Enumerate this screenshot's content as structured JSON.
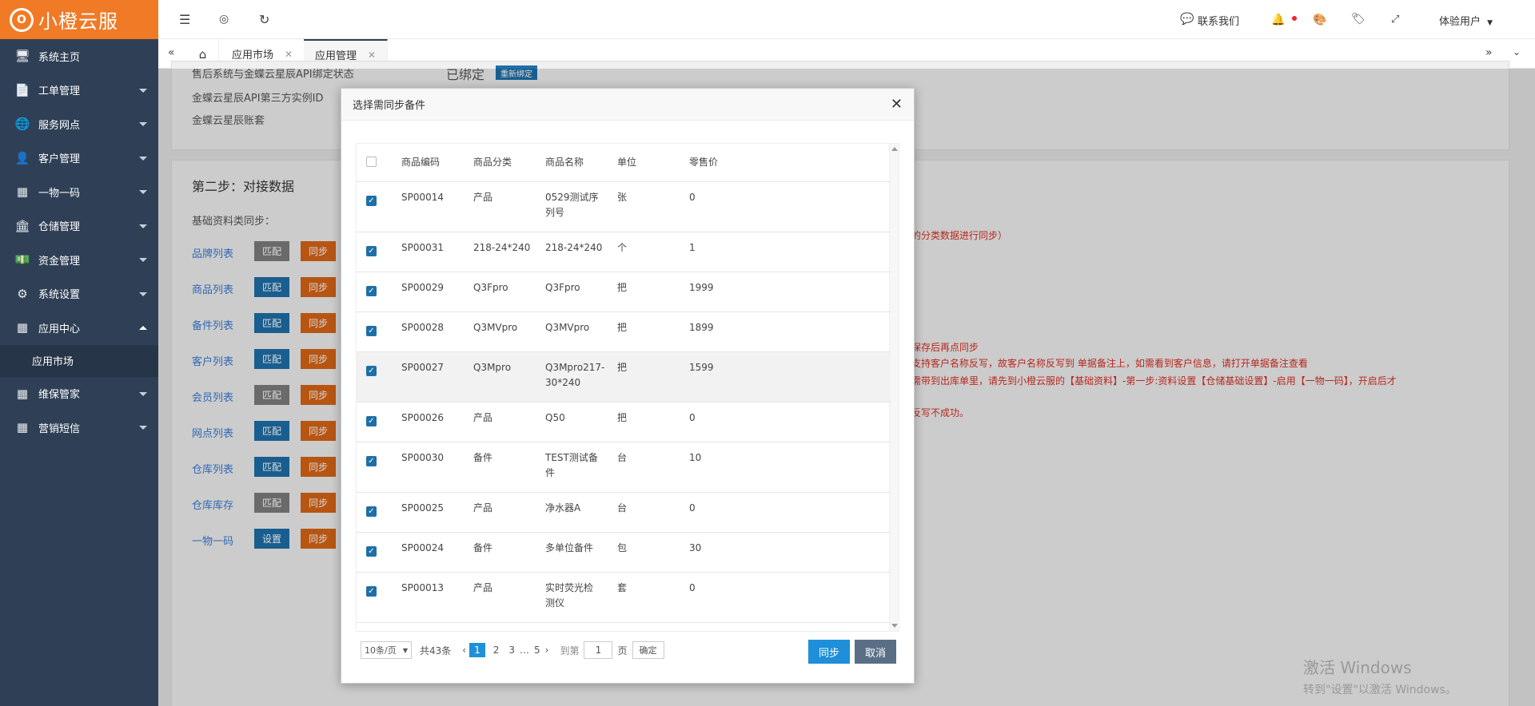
{
  "logo": {
    "mark": "O",
    "text": "小橙云服"
  },
  "sidebar": {
    "items": [
      {
        "icon": "monitor-icon",
        "glyph": "🖥",
        "label": "系统主页",
        "caret": false
      },
      {
        "icon": "document-icon",
        "glyph": "📄",
        "label": "工单管理",
        "caret": true
      },
      {
        "icon": "globe-icon",
        "glyph": "🌐",
        "label": "服务网点",
        "caret": true
      },
      {
        "icon": "user-icon",
        "glyph": "👤",
        "label": "客户管理",
        "caret": true
      },
      {
        "icon": "grid-icon",
        "glyph": "▦",
        "label": "一物一码",
        "caret": true
      },
      {
        "icon": "bank-icon",
        "glyph": "🏛",
        "label": "仓储管理",
        "caret": true
      },
      {
        "icon": "money-icon",
        "glyph": "💵",
        "label": "资金管理",
        "caret": true
      },
      {
        "icon": "gear-icon",
        "glyph": "⚙",
        "label": "系统设置",
        "caret": true
      },
      {
        "icon": "grid-icon",
        "glyph": "▦",
        "label": "应用中心",
        "caret": "up"
      }
    ],
    "sub_item": "应用市场",
    "items_after": [
      {
        "icon": "grid-icon",
        "glyph": "▦",
        "label": "维保管家"
      },
      {
        "icon": "grid-icon",
        "glyph": "▦",
        "label": "营销短信"
      }
    ]
  },
  "header": {
    "contact": "联系我们",
    "user": "体验用户"
  },
  "tabs": [
    {
      "label": "应用市场"
    },
    {
      "label": "应用管理"
    }
  ],
  "background": {
    "line1_label": "售后系统与金蝶云星辰API绑定状态",
    "line1_value": "已绑定",
    "line1_btn": "重新绑定",
    "line2_label": "金蝶云星辰API第三方实例ID",
    "line3_label": "金蝶云星辰账套",
    "step2": "第二步：对接数据",
    "basic_sync": "基础资料类同步：",
    "rows": [
      {
        "label": "品牌列表",
        "match": "匹配",
        "sync": "同步",
        "match_color": "grey"
      },
      {
        "label": "商品列表",
        "match": "匹配",
        "sync": "同步",
        "match_color": "blue"
      },
      {
        "label": "备件列表",
        "match": "匹配",
        "sync": "同步",
        "match_color": "blue"
      },
      {
        "label": "客户列表",
        "match": "匹配",
        "sync": "同步",
        "match_color": "blue"
      },
      {
        "label": "会员列表",
        "match": "匹配",
        "sync": "同步",
        "match_color": "grey"
      },
      {
        "label": "网点列表",
        "match": "匹配",
        "sync": "同步",
        "match_color": "blue"
      },
      {
        "label": "仓库列表",
        "match": "匹配",
        "sync": "同步",
        "match_color": "blue"
      },
      {
        "label": "仓库库存",
        "match": "匹配",
        "sync": "同步",
        "match_color": "grey"
      },
      {
        "label": "一物一码",
        "match": "设置",
        "sync": "同步",
        "match_color": "blue"
      }
    ],
    "red1": "的分类数据进行同步）",
    "red2": "保存后再点同步",
    "red3": "支持客户名称反写，故客户名称反写到 单据备注上，如需看到客户信息，请打开单据备注查看",
    "red4": "需带到出库单里，请先到小橙云服的【基础资料】-第一步:资料设置【仓储基础设置】-启用【一物一码】，开启后才",
    "red5": "反写不成功。"
  },
  "modal": {
    "title": "选择需同步备件",
    "columns": [
      "商品编码",
      "商品分类",
      "商品名称",
      "单位",
      "零售价"
    ],
    "rows": [
      {
        "code": "SP00014",
        "category": "产品",
        "name": [
          "0529测试序",
          "列号"
        ],
        "unit": "张",
        "price": "0"
      },
      {
        "code": "SP00031",
        "category": "218-24*240",
        "name": [
          "218-24*240"
        ],
        "unit": "个",
        "price": "1"
      },
      {
        "code": "SP00029",
        "category": "Q3Fpro",
        "name": [
          "Q3Fpro"
        ],
        "unit": "把",
        "price": "1999"
      },
      {
        "code": "SP00028",
        "category": "Q3MVpro",
        "name": [
          "Q3MVpro"
        ],
        "unit": "把",
        "price": "1899"
      },
      {
        "code": "SP00027",
        "category": "Q3Mpro",
        "name": [
          "Q3Mpro217-",
          "30*240"
        ],
        "unit": "把",
        "price": "1599"
      },
      {
        "code": "SP00026",
        "category": "产品",
        "name": [
          "Q50"
        ],
        "unit": "把",
        "price": "0"
      },
      {
        "code": "SP00030",
        "category": "备件",
        "name": [
          "TEST测试备",
          "件"
        ],
        "unit": "台",
        "price": "10"
      },
      {
        "code": "SP00025",
        "category": "产品",
        "name": [
          "净水器A"
        ],
        "unit": "台",
        "price": "0"
      },
      {
        "code": "SP00024",
        "category": "备件",
        "name": [
          "多单位备件"
        ],
        "unit": "包",
        "price": "30"
      },
      {
        "code": "SP00013",
        "category": "产品",
        "name": [
          "实时荧光检",
          "测仪"
        ],
        "unit": "套",
        "price": "0"
      }
    ],
    "pager": {
      "per_page": "10条/页",
      "total": "共43条",
      "pages": [
        "1",
        "2",
        "3",
        "…",
        "5"
      ],
      "goto": "到第",
      "goto_value": "1",
      "page_unit": "页",
      "confirm": "确定"
    },
    "sync_btn": "同步",
    "cancel_btn": "取消"
  },
  "watermark": {
    "line1": "激活 Windows",
    "line2": "转到\"设置\"以激活 Windows。"
  },
  "colors": {
    "sidebar": "#2f4056",
    "logo": "#f07a25",
    "primary": "#1e8fd8",
    "sync": "#d76417"
  }
}
